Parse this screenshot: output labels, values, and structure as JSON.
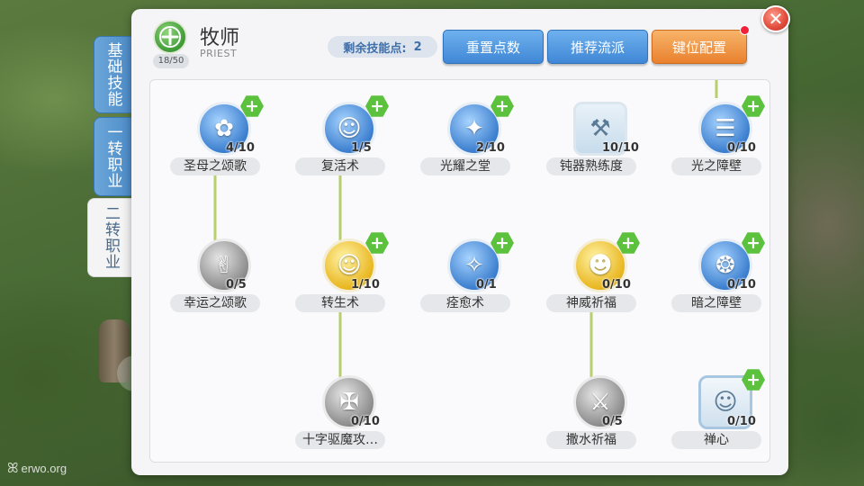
{
  "watermark": "erwo.org",
  "side_tabs": [
    {
      "label": "基础技能",
      "active": false
    },
    {
      "label": "一转职业",
      "active": false
    },
    {
      "label": "二转职业",
      "active": true
    }
  ],
  "header": {
    "class_name": "牧师",
    "class_sub": "PRIEST",
    "class_level": "18/50",
    "points_label": "剩余技能点:",
    "points_value": "2",
    "reset_button": "重置点数",
    "recommend_button": "推荐流派",
    "keybind_button": "键位配置",
    "close_glyph": "✕"
  },
  "colors": {
    "accent_blue": "#3f87d6",
    "accent_orange": "#e9812e",
    "plus_green": "#5cc23e",
    "link_line": "#b8cf6e"
  },
  "skills": [
    {
      "name": "圣母之颂歌",
      "level": "4/10",
      "orb": "blue",
      "icon": "maiden-icon",
      "glyph": "✿",
      "plus": true
    },
    {
      "name": "复活术",
      "level": "1/5",
      "orb": "blue",
      "icon": "angel-icon",
      "glyph": "☺",
      "plus": true
    },
    {
      "name": "光耀之堂",
      "level": "2/10",
      "orb": "blue",
      "icon": "light-hall-icon",
      "glyph": "✦",
      "plus": true
    },
    {
      "name": "钝器熟练度",
      "level": "10/10",
      "orb": "square-light",
      "icon": "mace-icon",
      "glyph": "⚒",
      "plus": false
    },
    {
      "name": "光之障壁",
      "level": "0/10",
      "orb": "blue",
      "icon": "barrier-icon",
      "glyph": "☰",
      "plus": true
    },
    {
      "name": "幸运之颂歌",
      "level": "0/5",
      "orb": "gray",
      "icon": "victory-hand-icon",
      "glyph": "✌",
      "plus": false
    },
    {
      "name": "转生术",
      "level": "1/10",
      "orb": "gold",
      "icon": "rebirth-icon",
      "glyph": "☺",
      "plus": true
    },
    {
      "name": "痊愈术",
      "level": "0/1",
      "orb": "blue",
      "icon": "healing-figure-icon",
      "glyph": "✧",
      "plus": true
    },
    {
      "name": "神威祈福",
      "level": "0/10",
      "orb": "gold",
      "icon": "blessing-face-icon",
      "glyph": "☻",
      "plus": true
    },
    {
      "name": "暗之障壁",
      "level": "0/10",
      "orb": "blue",
      "icon": "dark-barrier-icon",
      "glyph": "❂",
      "plus": true
    },
    {
      "name": "十字驱魔攻…",
      "level": "0/10",
      "orb": "gray",
      "icon": "cross-exorcism-icon",
      "glyph": "✠",
      "plus": false
    },
    {
      "name": "撒水祈福",
      "level": "0/5",
      "orb": "gray",
      "icon": "holy-water-icon",
      "glyph": "⚔",
      "plus": false
    },
    {
      "name": "禅心",
      "level": "0/10",
      "orb": "square-blue-light",
      "icon": "zen-face-icon",
      "glyph": "☺",
      "plus": true
    }
  ]
}
